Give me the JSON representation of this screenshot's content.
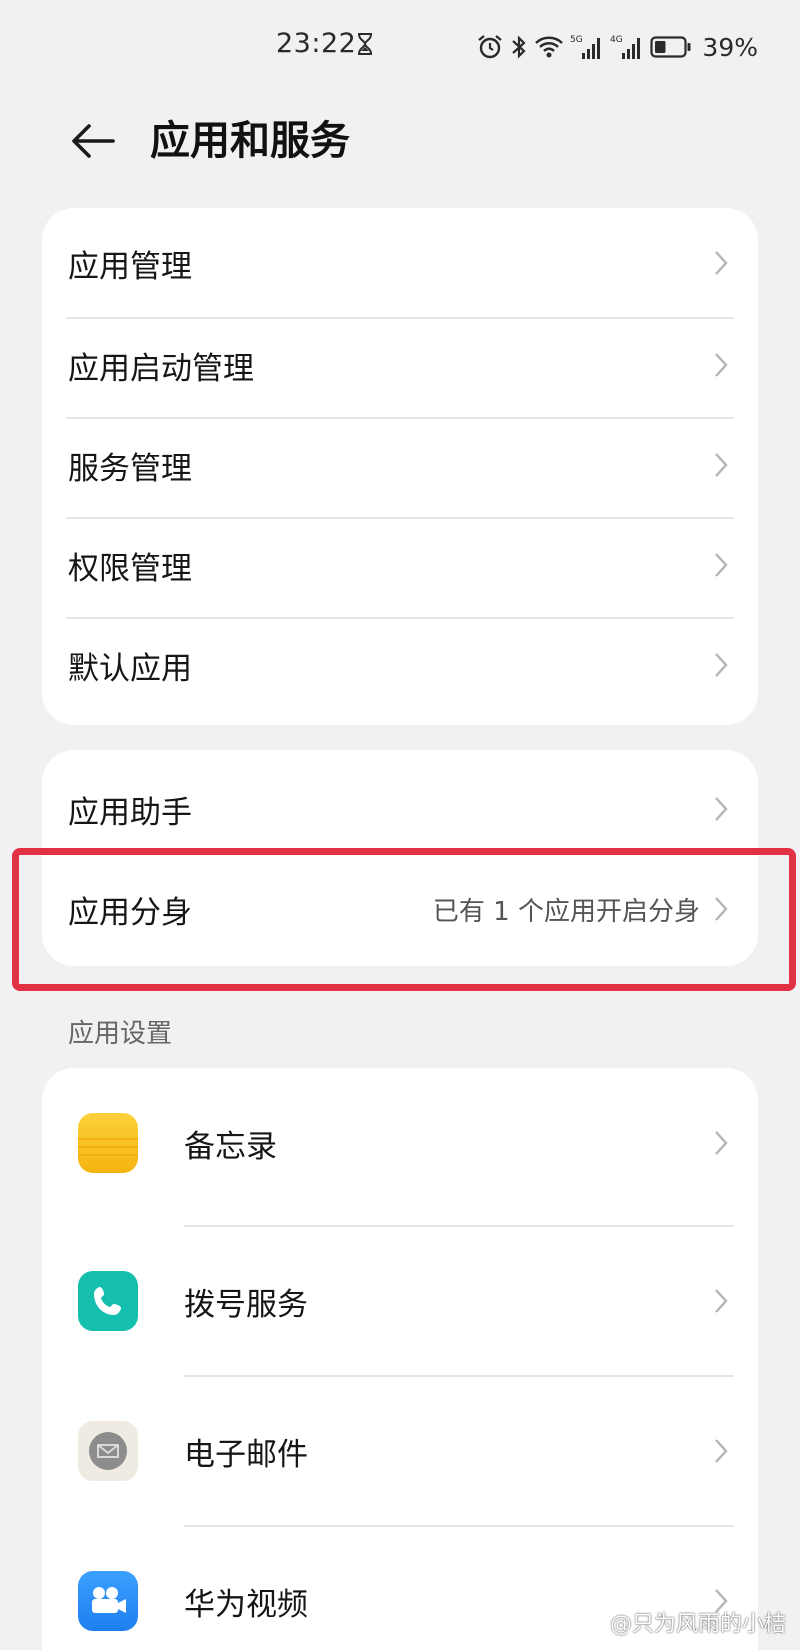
{
  "status_bar": {
    "time": "23:22",
    "battery_percent": "39%",
    "battery_level": 0.39,
    "signal_1_label": "5G",
    "signal_2_label": "4G",
    "icons": [
      "hourglass-icon",
      "alarm-icon",
      "bluetooth-icon",
      "wifi-icon",
      "signal-5g-icon",
      "signal-4g-icon",
      "battery-icon"
    ]
  },
  "header": {
    "back_icon": "back-arrow-icon",
    "title": "应用和服务"
  },
  "card_1": {
    "items": [
      {
        "label": "应用管理"
      },
      {
        "label": "应用启动管理"
      },
      {
        "label": "服务管理"
      },
      {
        "label": "权限管理"
      },
      {
        "label": "默认应用"
      }
    ]
  },
  "card_2": {
    "items": [
      {
        "label": "应用助手",
        "value": ""
      },
      {
        "label": "应用分身",
        "value": "已有 1 个应用开启分身"
      }
    ]
  },
  "app_settings": {
    "section_title": "应用设置",
    "items": [
      {
        "label": "备忘录",
        "icon": "notepad-icon",
        "color": "#f8c01a"
      },
      {
        "label": "拨号服务",
        "icon": "phone-icon",
        "color": "#14bfae"
      },
      {
        "label": "电子邮件",
        "icon": "mail-icon",
        "color": "#efeae2"
      },
      {
        "label": "华为视频",
        "icon": "video-camera-icon",
        "color": "#2a8ef5"
      }
    ]
  },
  "highlight": {
    "color": "#e03244"
  },
  "watermark": "@只为风雨的小桔"
}
